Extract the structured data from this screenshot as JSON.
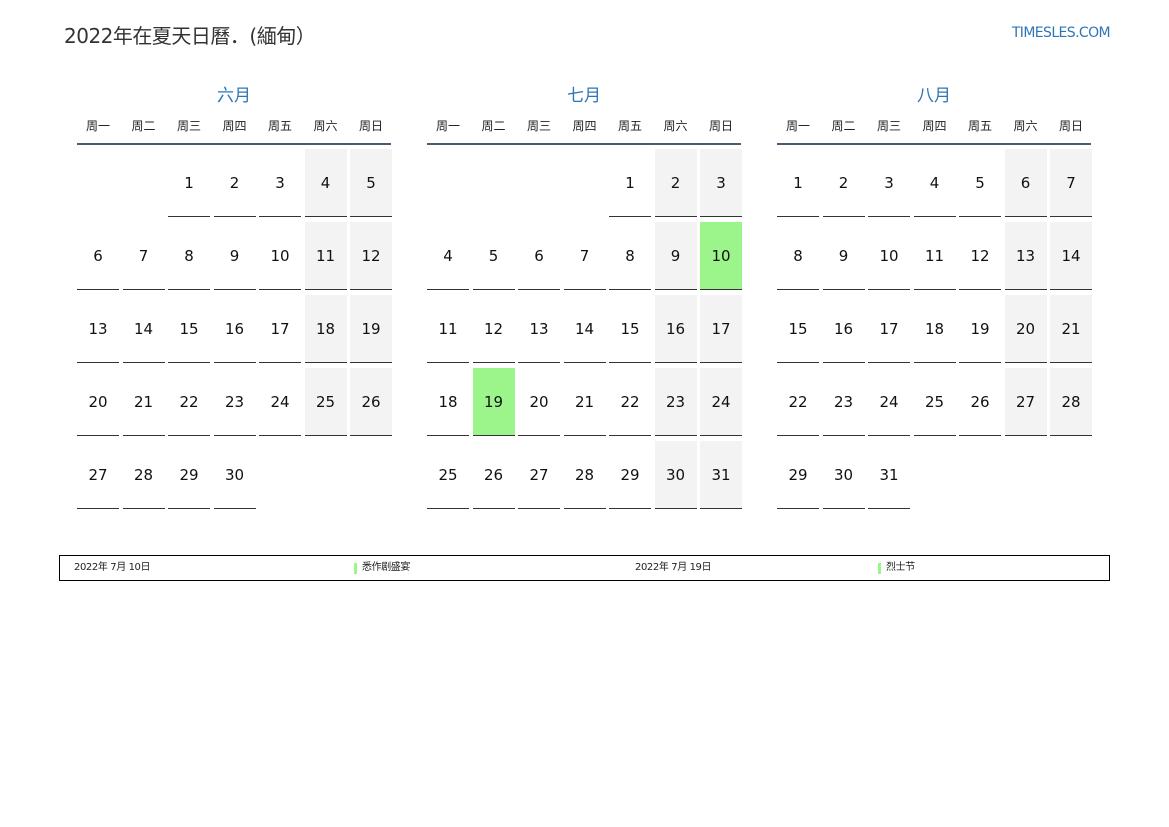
{
  "header": {
    "title": "2022年在夏天日曆．(緬甸）",
    "site": "TIMESLES.COM"
  },
  "colors": {
    "accent": "#2e75b6",
    "holiday": "#9cf58b",
    "weekend": "#f3f3f3"
  },
  "weekdays": [
    "周一",
    "周二",
    "周三",
    "周四",
    "周五",
    "周六",
    "周日"
  ],
  "months": [
    {
      "name": "六月",
      "weeks": [
        [
          null,
          null,
          1,
          2,
          3,
          4,
          5
        ],
        [
          6,
          7,
          8,
          9,
          10,
          11,
          12
        ],
        [
          13,
          14,
          15,
          16,
          17,
          18,
          19
        ],
        [
          20,
          21,
          22,
          23,
          24,
          25,
          26
        ],
        [
          27,
          28,
          29,
          30,
          null,
          null,
          null
        ]
      ],
      "holidays": []
    },
    {
      "name": "七月",
      "weeks": [
        [
          null,
          null,
          null,
          null,
          1,
          2,
          3
        ],
        [
          4,
          5,
          6,
          7,
          8,
          9,
          10
        ],
        [
          11,
          12,
          13,
          14,
          15,
          16,
          17
        ],
        [
          18,
          19,
          20,
          21,
          22,
          23,
          24
        ],
        [
          25,
          26,
          27,
          28,
          29,
          30,
          31
        ]
      ],
      "holidays": [
        10,
        19
      ]
    },
    {
      "name": "八月",
      "weeks": [
        [
          1,
          2,
          3,
          4,
          5,
          6,
          7
        ],
        [
          8,
          9,
          10,
          11,
          12,
          13,
          14
        ],
        [
          15,
          16,
          17,
          18,
          19,
          20,
          21
        ],
        [
          22,
          23,
          24,
          25,
          26,
          27,
          28
        ],
        [
          29,
          30,
          31,
          null,
          null,
          null,
          null
        ]
      ],
      "holidays": []
    }
  ],
  "legend": [
    {
      "date": "2022年 7月 10日",
      "name": "悉作剧盛宴"
    },
    {
      "date": "2022年 7月 19日",
      "name": "烈士节"
    }
  ]
}
